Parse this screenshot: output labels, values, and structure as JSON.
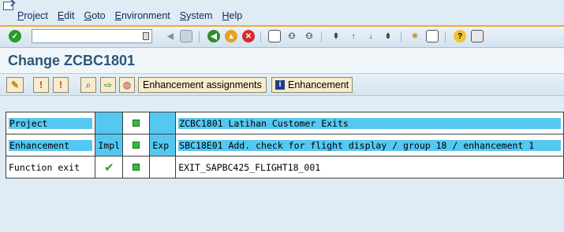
{
  "menu": [
    {
      "label": "Project",
      "accel_index": 0
    },
    {
      "label": "Edit",
      "accel_index": 0
    },
    {
      "label": "Goto",
      "accel_index": 0
    },
    {
      "label": "Environment",
      "accel_index": 0
    },
    {
      "label": "System",
      "accel_index": 0
    },
    {
      "label": "Help",
      "accel_index": 0
    }
  ],
  "command_field": {
    "value": ""
  },
  "title": "Change ZCBC1801",
  "app_toolbar": {
    "enh_assignments": "Enhancement assignments",
    "enhancement": "Enhancement"
  },
  "rows": [
    {
      "label": "Project",
      "impl": "",
      "exp": "",
      "text": "ZCBC1801 Latihan Customer Exits",
      "highlight": true,
      "status": "lamp"
    },
    {
      "label": "Enhancement",
      "impl": "Impl",
      "exp": "Exp",
      "text": "SBC18E01 Add. check for flight display / group 18 / enhancement 1",
      "highlight": true,
      "status": "lamp"
    },
    {
      "label": "Function exit",
      "impl": "check",
      "exp": "",
      "text": "EXIT_SAPBC425_FLIGHT18_001",
      "highlight": false,
      "status": "lamp"
    }
  ],
  "colors": {
    "accent": "#f0a83c",
    "title": "#2b5777",
    "highlight": "#55c8f2",
    "status_green": "#2fc236"
  }
}
